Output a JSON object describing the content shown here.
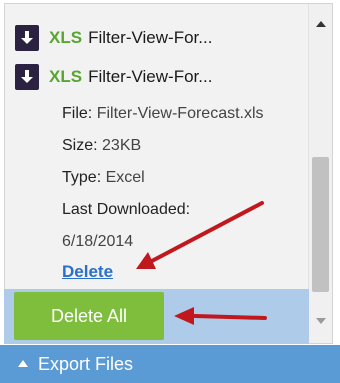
{
  "downloads": [
    {
      "ext": "XLS",
      "name": "Filter-View-For...",
      "icon": "download-icon"
    },
    {
      "ext": "XLS",
      "name": "Filter-View-For...",
      "icon": "download-icon"
    }
  ],
  "details": {
    "file_label": "File:",
    "file_value": "Filter-View-Forecast.xls",
    "size_label": "Size:",
    "size_value": "23KB",
    "type_label": "Type:",
    "type_value": "Excel",
    "last_label": "Last Downloaded:",
    "last_value": "6/18/2014"
  },
  "delete_link": "Delete",
  "delete_all": "Delete All",
  "export_label": "Export Files",
  "colors": {
    "xls_green": "#58a531",
    "delete_all_bg": "#7fbe3c",
    "export_bar": "#5b9bd5",
    "annotation_arrow": "#c0181c"
  }
}
